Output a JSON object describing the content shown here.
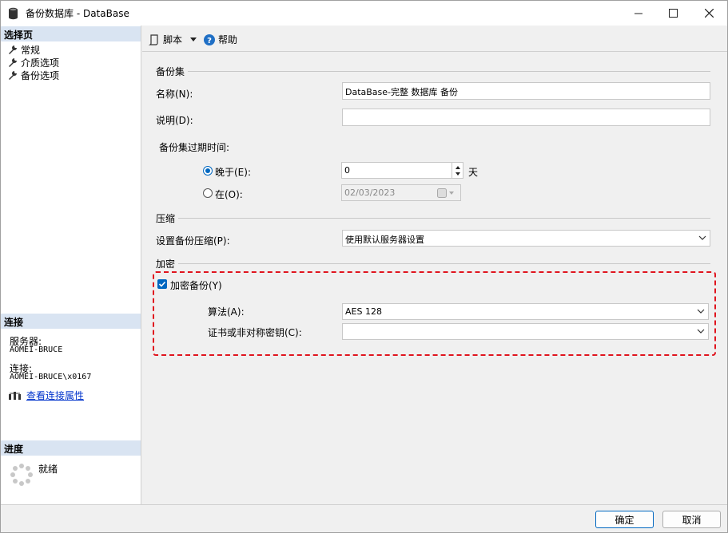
{
  "window": {
    "title": "备份数据库 - DataBase"
  },
  "left": {
    "select_page_header": "选择页",
    "pages": [
      "常规",
      "介质选项",
      "备份选项"
    ],
    "connection_header": "连接",
    "server_label": "服务器:",
    "server_value": "AOMEI-BRUCE",
    "connection_label": "连接:",
    "connection_value": "AOMEI-BRUCE\\x0167",
    "view_props_link": "查看连接属性",
    "progress_header": "进度",
    "progress_status": "就绪"
  },
  "toolbar": {
    "script_label": "脚本",
    "help_label": "帮助"
  },
  "backup_set": {
    "group_label": "备份集",
    "name_label": "名称(N):",
    "name_value": "DataBase-完整 数据库 备份",
    "desc_label": "说明(D):",
    "desc_value": "",
    "expire_label": "备份集过期时间:",
    "after_label": "晚于(E):",
    "after_value": "0",
    "days_label": "天",
    "on_label": "在(O):",
    "on_value": "02/03/2023"
  },
  "compression": {
    "group_label": "压缩",
    "set_label": "设置备份压缩(P):",
    "set_value": "使用默认服务器设置"
  },
  "encryption": {
    "group_label": "加密",
    "encrypt_label": "加密备份(Y)",
    "encrypt_checked": true,
    "algorithm_label": "算法(A):",
    "algorithm_value": "AES 128",
    "cert_label": "证书或非对称密钥(C):",
    "cert_value": ""
  },
  "footer": {
    "ok_label": "确定",
    "cancel_label": "取消"
  },
  "colors": {
    "accent": "#0067c0",
    "highlight_border": "#e0141e",
    "section_header": "#d9e4f2"
  }
}
